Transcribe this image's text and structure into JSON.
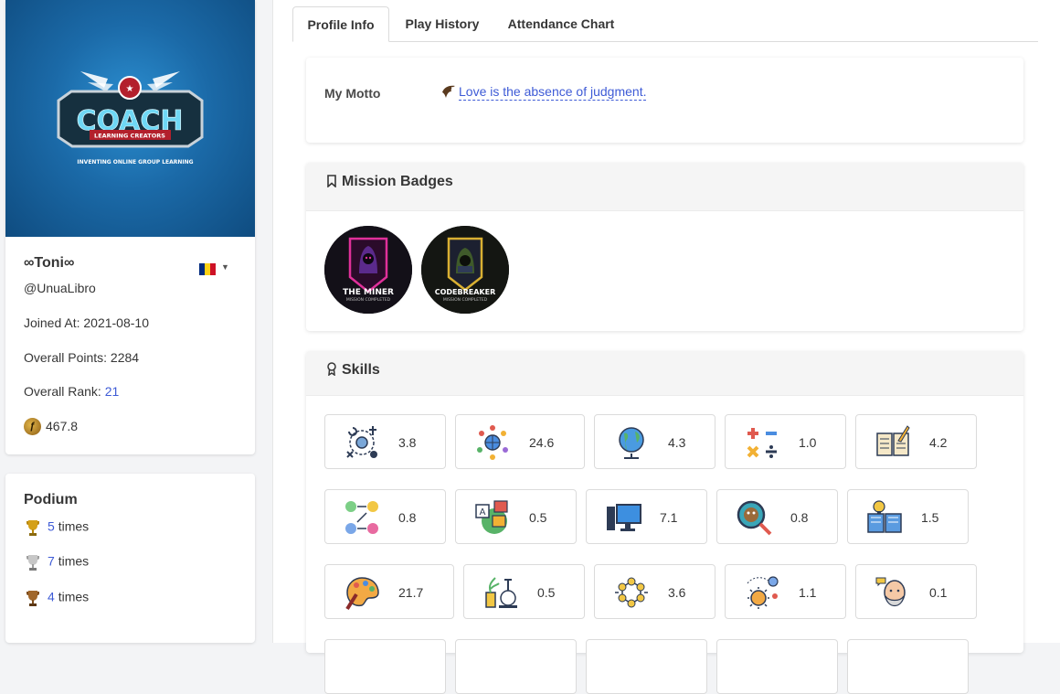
{
  "banner": {
    "logo_text": "COACH",
    "logo_subtitle": "LEARNING CREATORS",
    "tagline": "INVENTING ONLINE GROUP LEARNING"
  },
  "profile": {
    "name": "∞Toni∞",
    "handle": "@UnuaLibro",
    "joined": "Joined At: 2021-08-10",
    "points": "Overall Points: 2284",
    "rank_label": "Overall Rank: ",
    "rank_value": "21",
    "coin_balance": "467.8",
    "flag_colors": [
      "#002B7F",
      "#FCD116",
      "#CE1126"
    ]
  },
  "podium": {
    "title": "Podium",
    "rows": [
      {
        "count": "5",
        "label": "times",
        "color": "#d4a017"
      },
      {
        "count": "7",
        "label": "times",
        "color": "#b8b8b8"
      },
      {
        "count": "4",
        "label": "times",
        "color": "#a0662a"
      }
    ]
  },
  "tabs": [
    {
      "label": "Profile Info",
      "active": true
    },
    {
      "label": "Play History",
      "active": false
    },
    {
      "label": "Attendance Chart",
      "active": false
    }
  ],
  "motto": {
    "label": "My Motto",
    "text": "Love is the absence of judgment."
  },
  "badges": {
    "title": "Mission Badges",
    "items": [
      {
        "line1": "THE MINER",
        "line2": "MISSION COMPLETED",
        "color": "#e0309a"
      },
      {
        "line1": "CODEBREAKER",
        "line2": "MISSION COMPLETED",
        "color": "#d9b032"
      }
    ]
  },
  "skills": {
    "title": "Skills",
    "items": [
      {
        "value": "3.8",
        "icon": "spirituality-icon"
      },
      {
        "value": "24.6",
        "icon": "global-network-icon"
      },
      {
        "value": "4.3",
        "icon": "globe-icon"
      },
      {
        "value": "1.0",
        "icon": "math-icon"
      },
      {
        "value": "4.2",
        "icon": "literature-icon"
      },
      {
        "value": "0.8",
        "icon": "logic-flow-icon"
      },
      {
        "value": "0.5",
        "icon": "languages-icon"
      },
      {
        "value": "7.1",
        "icon": "computer-icon"
      },
      {
        "value": "0.8",
        "icon": "monkey-search-icon"
      },
      {
        "value": "1.5",
        "icon": "idea-book-icon"
      },
      {
        "value": "21.7",
        "icon": "art-palette-icon"
      },
      {
        "value": "0.5",
        "icon": "biology-lab-icon"
      },
      {
        "value": "3.6",
        "icon": "molecule-icon"
      },
      {
        "value": "1.1",
        "icon": "astronomy-icon"
      },
      {
        "value": "0.1",
        "icon": "philosopher-icon"
      }
    ]
  }
}
